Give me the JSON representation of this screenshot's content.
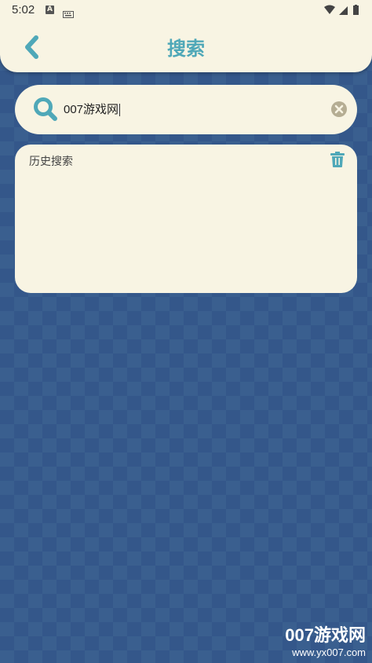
{
  "status_bar": {
    "time": "5:02",
    "a_badge": "A"
  },
  "header": {
    "title": "搜索"
  },
  "search": {
    "value": "007游戏网"
  },
  "history": {
    "title": "历史搜索"
  },
  "watermark": {
    "brand": "007游戏网",
    "url": "www.yx007.com"
  },
  "colors": {
    "accent": "#4fa8b8",
    "panel": "#f8f4e3",
    "background": "#3a5f8f"
  }
}
